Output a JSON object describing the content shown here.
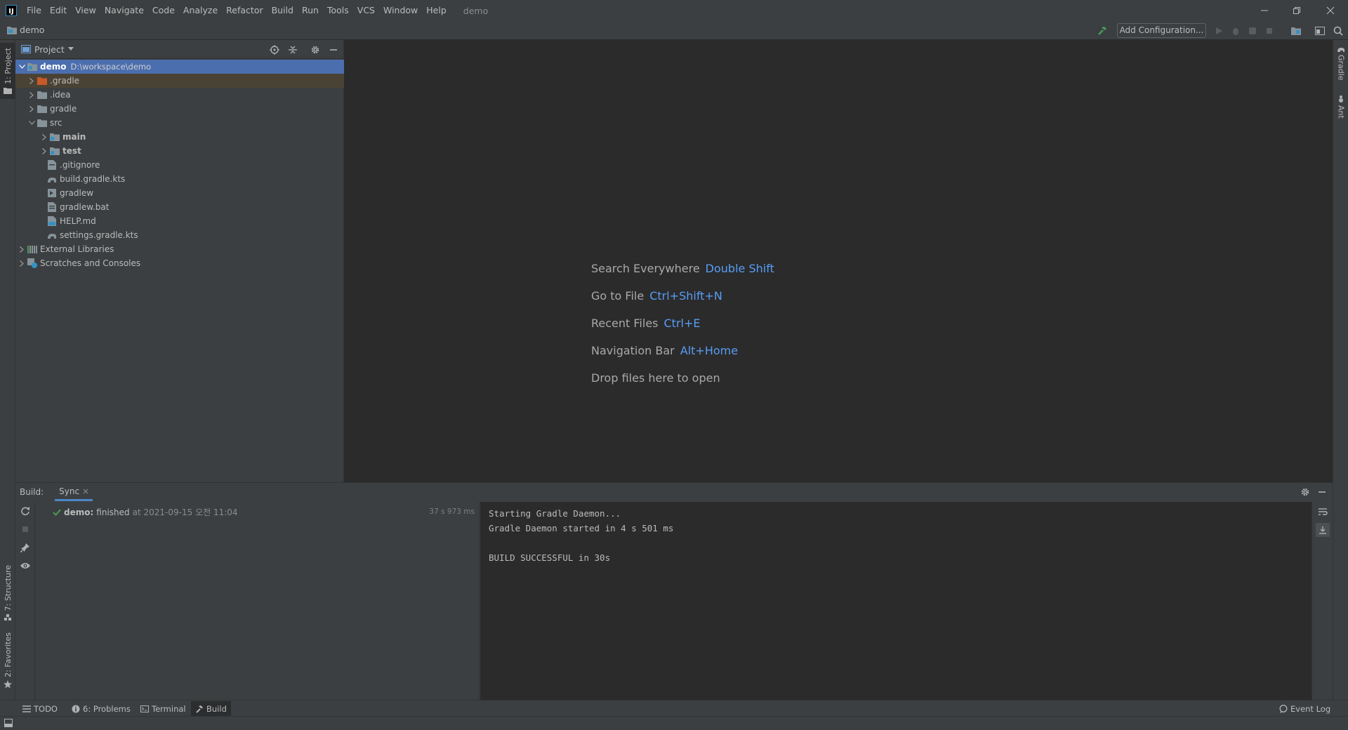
{
  "app": {
    "logo_letter": "IJ",
    "menu": [
      "File",
      "Edit",
      "View",
      "Navigate",
      "Code",
      "Analyze",
      "Refactor",
      "Build",
      "Run",
      "Tools",
      "VCS",
      "Window",
      "Help"
    ],
    "window_title": "demo"
  },
  "navbar": {
    "project_name": "demo",
    "add_configuration_label": "Add Configuration..."
  },
  "left_stripe": {
    "project_tab": "1: Project",
    "structure_tab": "7: Structure",
    "favorites_tab": "2: Favorites"
  },
  "right_stripe": {
    "gradle_tab": "Gradle",
    "ant_tab": "Ant"
  },
  "project_panel": {
    "title": "Project",
    "tree": [
      {
        "label": "demo",
        "path": "D:\\workspace\\demo"
      },
      {
        "label": ".gradle"
      },
      {
        "label": ".idea"
      },
      {
        "label": "gradle"
      },
      {
        "label": "src"
      },
      {
        "label": "main"
      },
      {
        "label": "test"
      },
      {
        "label": ".gitignore"
      },
      {
        "label": "build.gradle.kts"
      },
      {
        "label": "gradlew"
      },
      {
        "label": "gradlew.bat"
      },
      {
        "label": "HELP.md"
      },
      {
        "label": "settings.gradle.kts"
      },
      {
        "label": "External Libraries"
      },
      {
        "label": "Scratches and Consoles"
      }
    ]
  },
  "editor": {
    "hints": [
      {
        "label": "Search Everywhere",
        "key": "Double Shift"
      },
      {
        "label": "Go to File",
        "key": "Ctrl+Shift+N"
      },
      {
        "label": "Recent Files",
        "key": "Ctrl+E"
      },
      {
        "label": "Navigation Bar",
        "key": "Alt+Home"
      },
      {
        "label": "Drop files here to open",
        "key": ""
      }
    ]
  },
  "build": {
    "label": "Build:",
    "tab": "Sync",
    "result_name": "demo:",
    "result_status": "finished",
    "result_at": "at 2021-09-15 오전 11:04",
    "duration": "37 s 973 ms",
    "console_lines": [
      "Starting Gradle Daemon...",
      "Gradle Daemon started in 4 s 501 ms",
      "",
      "BUILD SUCCESSFUL in 30s"
    ]
  },
  "bottom_tabs": {
    "todo": "TODO",
    "problems": "6: Problems",
    "terminal": "Terminal",
    "build": "Build",
    "event_log": "Event Log"
  },
  "colors": {
    "selection": "#4b6eaf",
    "shortcut": "#589df6",
    "success": "#499c54",
    "gradle_folder": "#c75a28"
  }
}
